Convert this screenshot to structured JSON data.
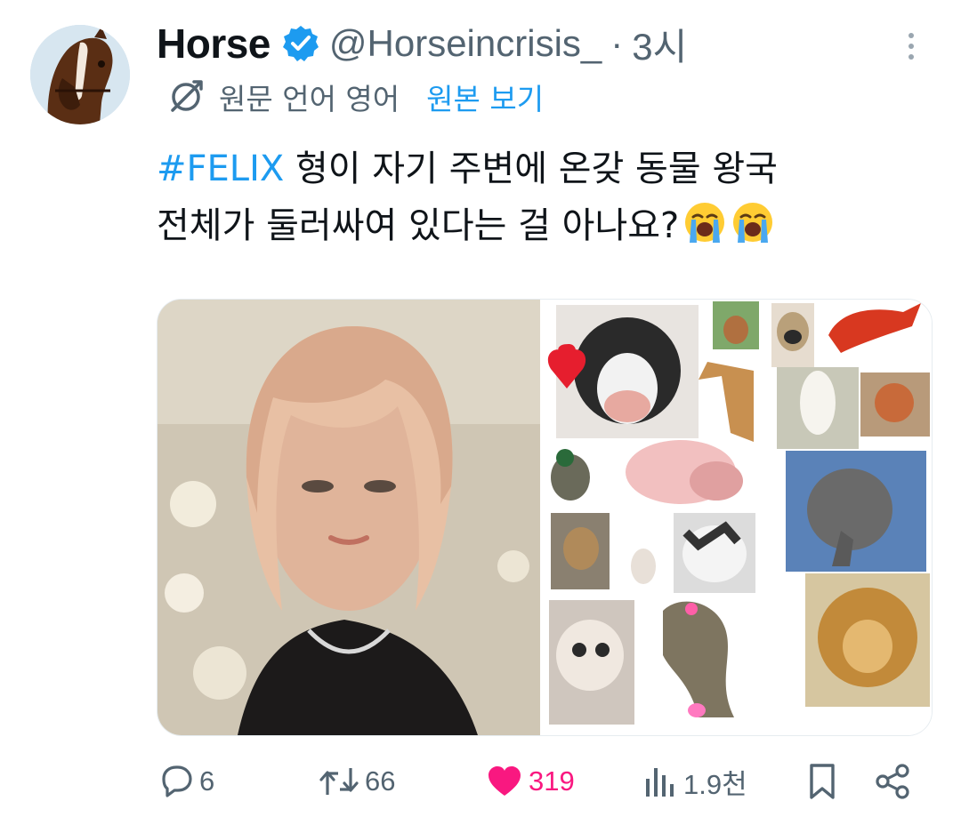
{
  "author": {
    "display_name": "Horse",
    "handle": "@Horseincrisis_",
    "separator": "·",
    "time": "3시",
    "verified": true,
    "avatar_icon": "horse-avatar"
  },
  "translation": {
    "note": "원문 언어 영어",
    "show_original": "원본 보기",
    "icon": "translate-icon"
  },
  "tweet": {
    "hashtag": "#FELIX",
    "line1": " 형이 자기 주변에 온갖 동물 왕국",
    "line2": "전체가 둘러싸여 있다는 걸 아나요?",
    "emoji": [
      "loudly-crying-face",
      "loudly-crying-face"
    ]
  },
  "media": [
    {
      "icon": "portrait-photo"
    },
    {
      "icon": "animal-collage-photo"
    }
  ],
  "actions": {
    "reply_count": "6",
    "retweet_count": "66",
    "like_count": "319",
    "view_count": "1.9천"
  },
  "colors": {
    "link": "#1d9bf0",
    "secondary_text": "#536471",
    "like": "#f91880",
    "verified": "#1d9bf0"
  }
}
